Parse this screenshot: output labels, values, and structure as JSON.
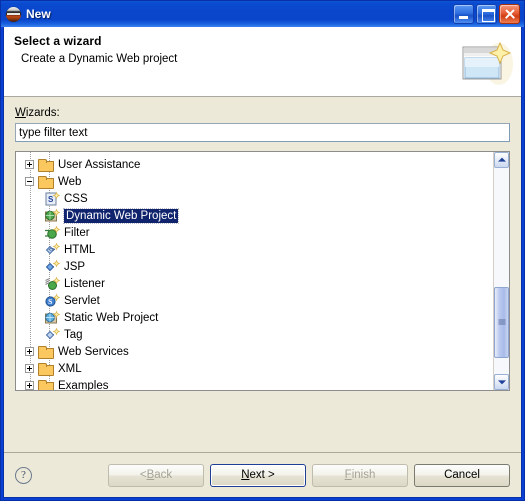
{
  "window": {
    "title": "New",
    "app_icon": "eclipse-icon",
    "controls": [
      {
        "name": "minimize",
        "glyph": "minimize-icon"
      },
      {
        "name": "maximize",
        "glyph": "maximize-icon"
      },
      {
        "name": "close",
        "glyph": "close-icon"
      }
    ]
  },
  "header": {
    "title": "Select a wizard",
    "description": "Create a Dynamic Web project",
    "icon": "wizard-page-icon"
  },
  "form": {
    "wizards_label_mnemonic": "W",
    "wizards_label_rest": "izards:",
    "filter_value": "type filter text",
    "filter_placeholder": "type filter text"
  },
  "tree": {
    "items": [
      {
        "label": "User Assistance",
        "level": 0,
        "icon": "folder-icon",
        "twisty": "plus",
        "selected": false
      },
      {
        "label": "Web",
        "level": 0,
        "icon": "folder-icon",
        "twisty": "minus",
        "selected": false
      },
      {
        "label": "CSS",
        "level": 1,
        "icon": "css-file-icon",
        "twisty": "none",
        "selected": false
      },
      {
        "label": "Dynamic Web Project",
        "level": 1,
        "icon": "dynamic-web-project-icon",
        "twisty": "none",
        "selected": true
      },
      {
        "label": "Filter",
        "level": 1,
        "icon": "filter-icon",
        "twisty": "none",
        "selected": false
      },
      {
        "label": "HTML",
        "level": 1,
        "icon": "html-file-icon",
        "twisty": "none",
        "selected": false
      },
      {
        "label": "JSP",
        "level": 1,
        "icon": "jsp-file-icon",
        "twisty": "none",
        "selected": false
      },
      {
        "label": "Listener",
        "level": 1,
        "icon": "listener-icon",
        "twisty": "none",
        "selected": false
      },
      {
        "label": "Servlet",
        "level": 1,
        "icon": "servlet-icon",
        "twisty": "none",
        "selected": false
      },
      {
        "label": "Static Web Project",
        "level": 1,
        "icon": "static-web-project-icon",
        "twisty": "none",
        "selected": false
      },
      {
        "label": "Tag",
        "level": 1,
        "icon": "tag-file-icon",
        "twisty": "none",
        "selected": false
      },
      {
        "label": "Web Services",
        "level": 0,
        "icon": "folder-icon",
        "twisty": "plus",
        "selected": false
      },
      {
        "label": "XML",
        "level": 0,
        "icon": "folder-icon",
        "twisty": "plus",
        "selected": false
      },
      {
        "label": "Examples",
        "level": 0,
        "icon": "folder-icon",
        "twisty": "plus",
        "selected": false
      }
    ],
    "scrollbar": {
      "up": "scroll-up-arrow",
      "down": "scroll-down-arrow",
      "thumb_top_pct": 58,
      "thumb_height_pct": 34
    }
  },
  "buttons": {
    "help": "?",
    "back": {
      "label": "< Back",
      "mnemonic": "B",
      "pre": "< ",
      "post": "ack",
      "enabled": false,
      "default": false
    },
    "next": {
      "label": "Next >",
      "mnemonic": "N",
      "pre": "",
      "post": "ext >",
      "enabled": true,
      "default": true
    },
    "finish": {
      "label": "Finish",
      "mnemonic": "F",
      "pre": "",
      "post": "inish",
      "enabled": false,
      "default": false
    },
    "cancel": {
      "label": "Cancel",
      "mnemonic": "",
      "pre": "",
      "post": "",
      "enabled": true,
      "default": false
    }
  },
  "colors": {
    "title_bar": "#0a46cc",
    "dialog_face": "#ece9d8",
    "selection": "#10246e",
    "close_button": "#e65c34",
    "folder": "#fbc85f"
  }
}
